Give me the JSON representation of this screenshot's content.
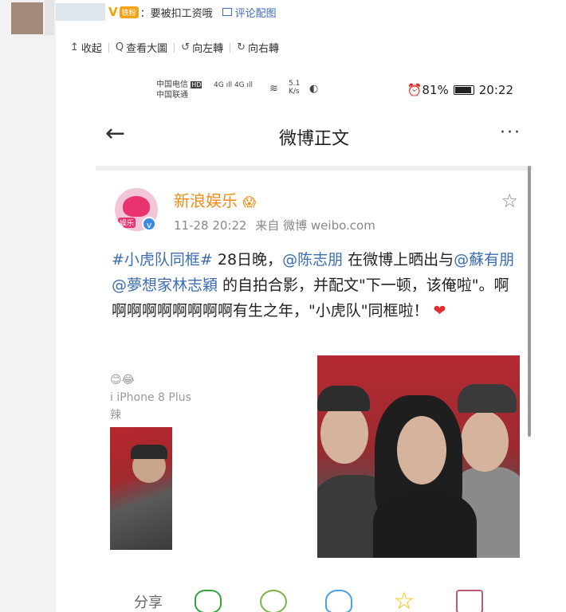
{
  "comment": {
    "badge": "V",
    "fan_badge": "铁粉",
    "text": "：要被扣工资哦",
    "pic_link": "评论配图"
  },
  "toolbar": {
    "collapse": "收起",
    "view_large": "查看大圖",
    "rotate_left": "向左轉",
    "rotate_right": "向右轉",
    "glyph_collapse": "↥",
    "glyph_view": "Q",
    "glyph_left": "↺",
    "glyph_right": "↻"
  },
  "screenshot": {
    "status": {
      "carrier1": "中国电信",
      "carrier2": "中国联通",
      "hd": "HD",
      "sig1": "4G",
      "sig2": "4G",
      "speed_val": "5.1",
      "speed_unit": "K/s",
      "alarm_battery": "⏰81%",
      "time": "20:22"
    },
    "nav": {
      "back": "←",
      "title": "微博正文",
      "more": "···"
    },
    "post": {
      "avatar_label": "娱乐",
      "verify": "v",
      "name": "新浪娱乐",
      "name_emoji": "😱",
      "star": "☆",
      "time": "11-28 20:22",
      "source": "来自 微博 weibo.com",
      "tag": "#小虎队同框#",
      "text1": " 28日晚，",
      "mention1": "@陈志朋",
      "text2": " 在微博上晒出与",
      "mention2": "@蘇有朋",
      "text3": " ",
      "mention3": "@夢想家林志穎",
      "text4": " 的自拍合影，并配文\"下一顿，该俺啦\"。啊啊啊啊啊啊啊啊啊有生之年，\"小虎队\"同框啦！",
      "heart": "❤",
      "strip1": "😊😂",
      "strip2": "i iPhone 8 Plus",
      "strip3": "辣"
    },
    "share_label": "分享"
  }
}
